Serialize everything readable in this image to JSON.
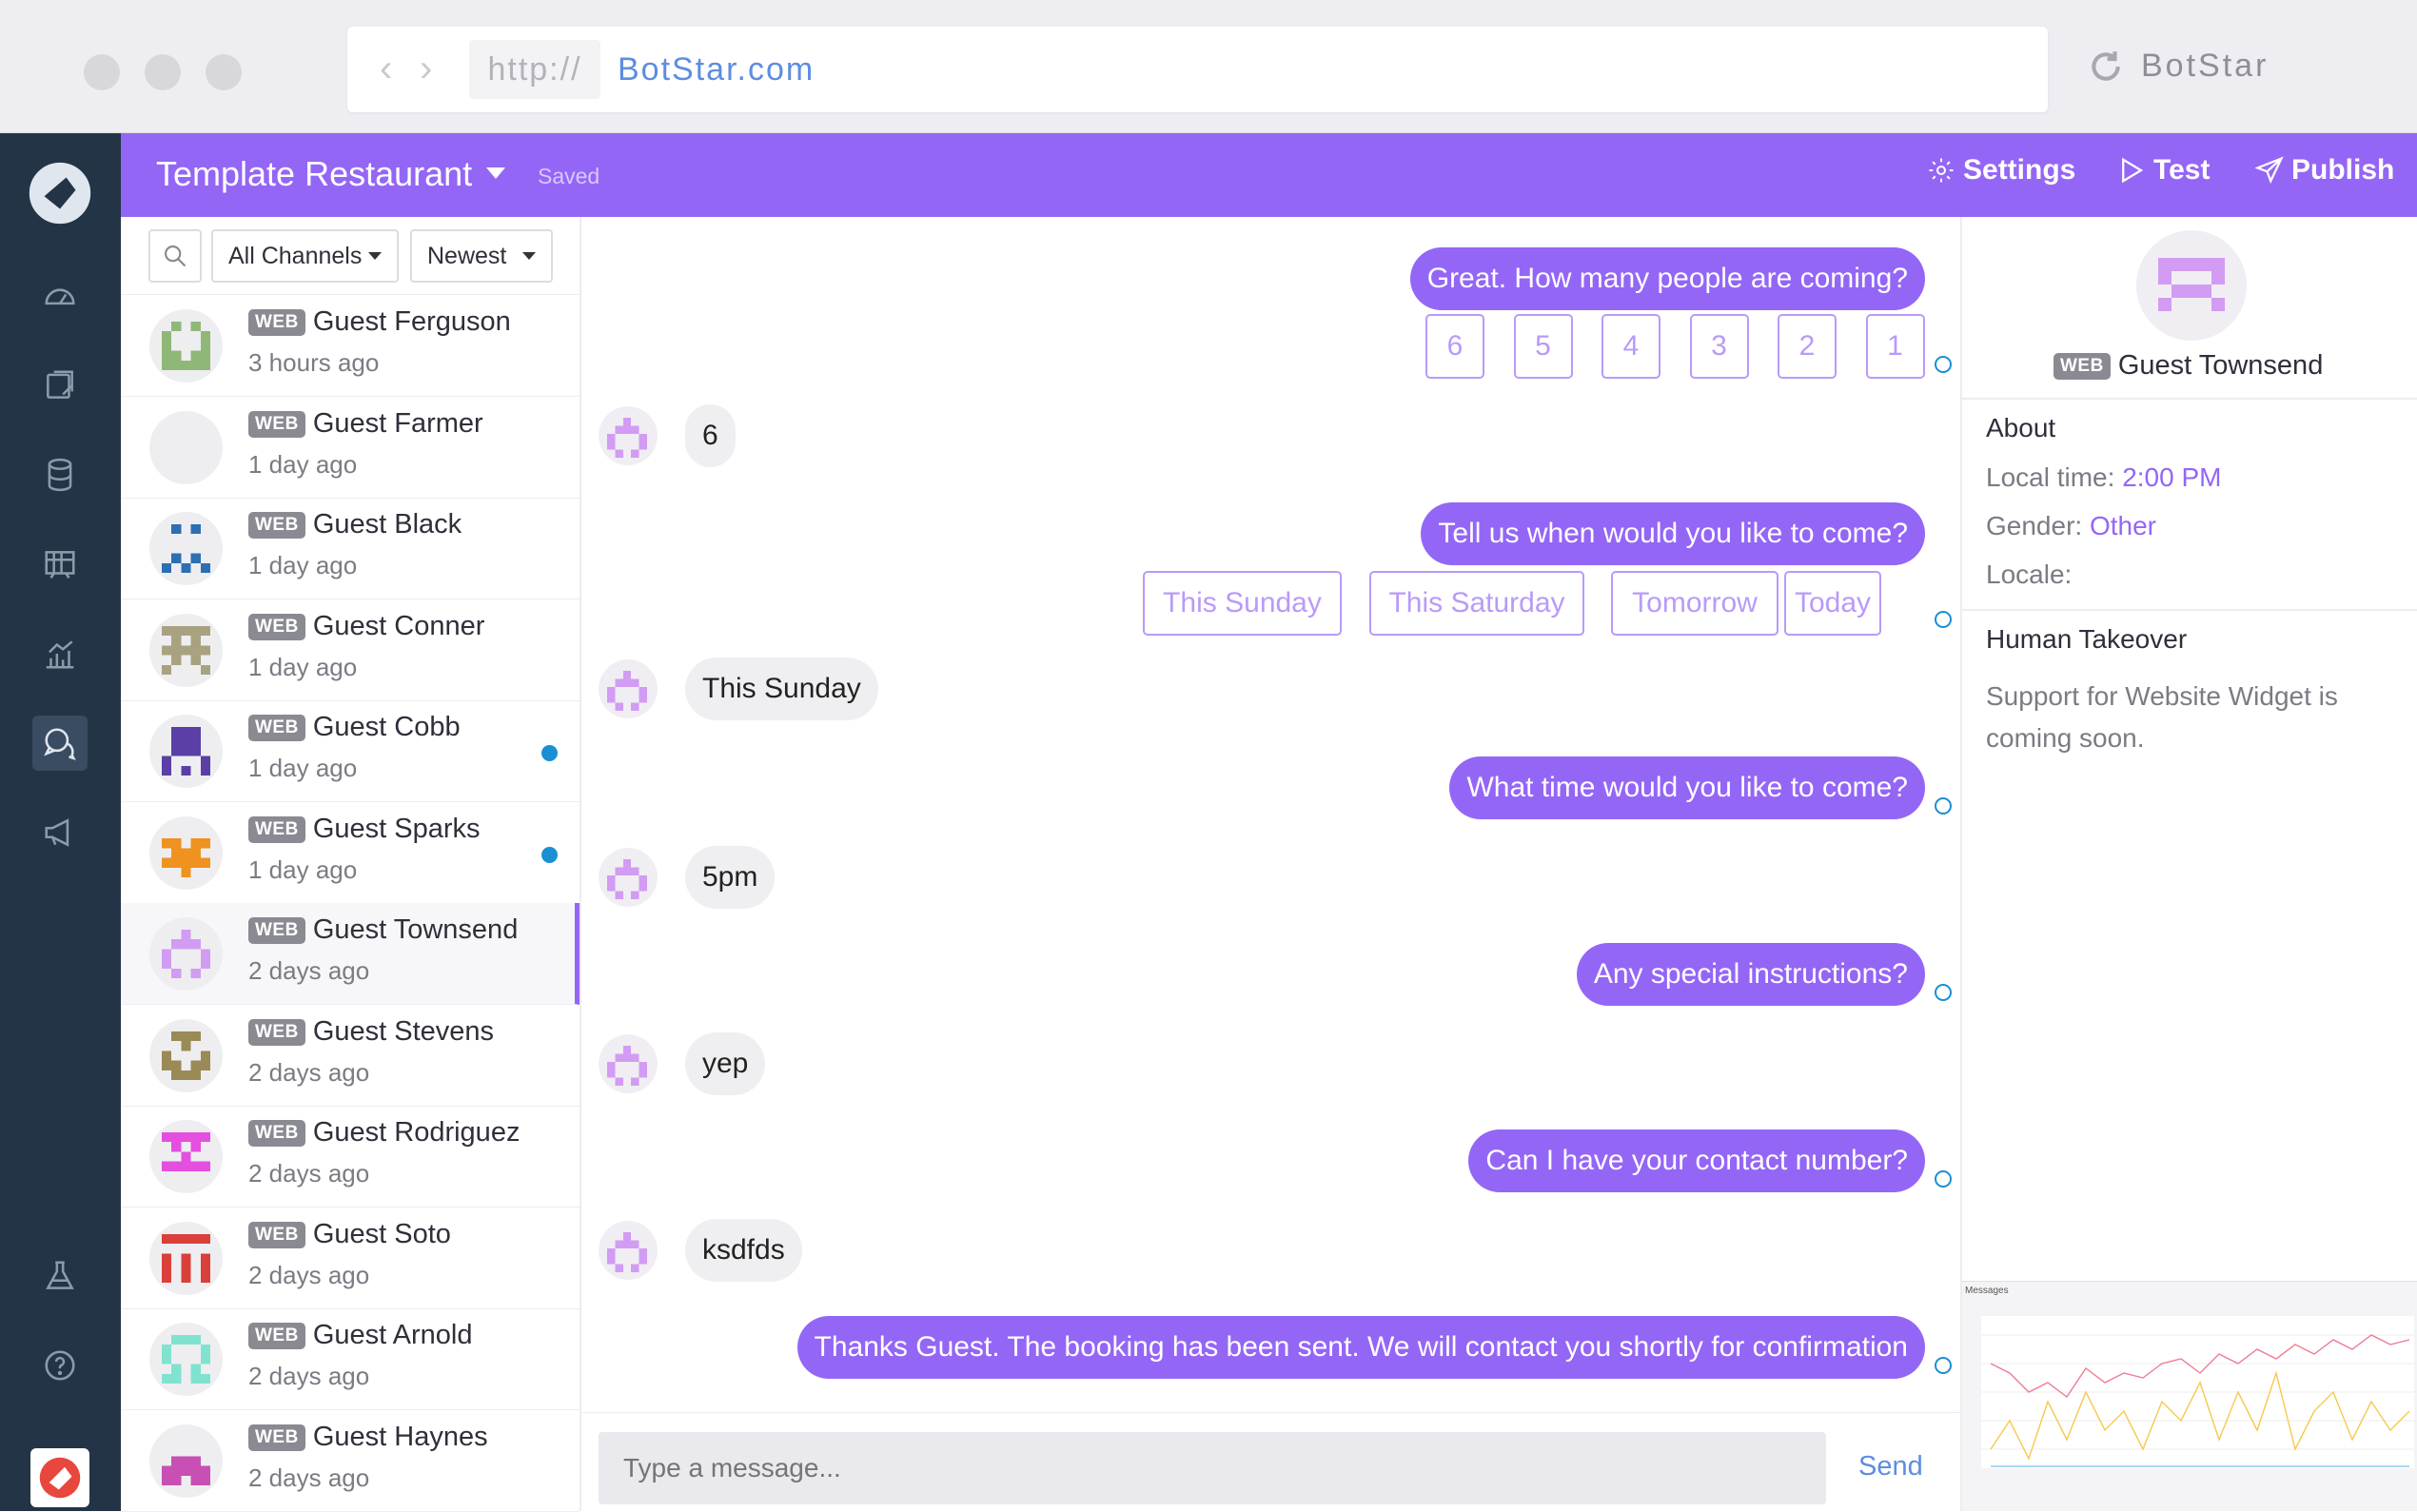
{
  "browser": {
    "url_protocol": "http://",
    "url_domain": "BotStar.com",
    "brand": "BotStar"
  },
  "topbar": {
    "title": "Template Restaurant",
    "status": "Saved",
    "settings_label": "Settings",
    "test_label": "Test",
    "publish_label": "Publish"
  },
  "filters": {
    "channel": "All Channels",
    "sort": "Newest"
  },
  "conversations": [
    {
      "channel": "WEB",
      "name": "Guest Ferguson",
      "time": "3 hours ago",
      "color": "#8fb878",
      "unread": false
    },
    {
      "channel": "WEB",
      "name": "Guest Farmer",
      "time": "1 day ago",
      "color": "#e6d00a",
      "unread": false
    },
    {
      "channel": "WEB",
      "name": "Guest Black",
      "time": "1 day ago",
      "color": "#2c6fb2",
      "unread": false
    },
    {
      "channel": "WEB",
      "name": "Guest Conner",
      "time": "1 day ago",
      "color": "#a9a280",
      "unread": false
    },
    {
      "channel": "WEB",
      "name": "Guest Cobb",
      "time": "1 day ago",
      "color": "#5a3fa6",
      "unread": true
    },
    {
      "channel": "WEB",
      "name": "Guest Sparks",
      "time": "1 day ago",
      "color": "#ef9220",
      "unread": true
    },
    {
      "channel": "WEB",
      "name": "Guest Townsend",
      "time": "2 days ago",
      "color": "#d29cf3",
      "unread": false
    },
    {
      "channel": "WEB",
      "name": "Guest Stevens",
      "time": "2 days ago",
      "color": "#9a8a56",
      "unread": false
    },
    {
      "channel": "WEB",
      "name": "Guest Rodriguez",
      "time": "2 days ago",
      "color": "#e44fe0",
      "unread": false
    },
    {
      "channel": "WEB",
      "name": "Guest Soto",
      "time": "2 days ago",
      "color": "#d9403a",
      "unread": false
    },
    {
      "channel": "WEB",
      "name": "Guest Arnold",
      "time": "2 days ago",
      "color": "#7fe3cf",
      "unread": false
    },
    {
      "channel": "WEB",
      "name": "Guest Haynes",
      "time": "2 days ago",
      "color": "#c84fb4",
      "unread": false
    }
  ],
  "chat": {
    "messages": [
      {
        "from": "bot",
        "text": "Great. How many people are coming?",
        "quick_replies": [
          "6",
          "5",
          "4",
          "3",
          "2",
          "1"
        ]
      },
      {
        "from": "user",
        "text": "6"
      },
      {
        "from": "bot",
        "text": "Tell us when would you like to come?",
        "quick_replies": [
          "This Sunday",
          "This Saturday",
          "Tomorrow",
          "Today"
        ]
      },
      {
        "from": "user",
        "text": "This Sunday"
      },
      {
        "from": "bot",
        "text": "What time would you like to come?"
      },
      {
        "from": "user",
        "text": "5pm"
      },
      {
        "from": "bot",
        "text": "Any special instructions?"
      },
      {
        "from": "user",
        "text": "yep"
      },
      {
        "from": "bot",
        "text": "Can I have your contact number?"
      },
      {
        "from": "user",
        "text": "ksdfds"
      },
      {
        "from": "bot",
        "text": "Thanks Guest. The booking has been sent. We will contact you shortly for confirmation"
      }
    ],
    "composer_placeholder": "Type a message...",
    "send_label": "Send"
  },
  "profile": {
    "channel": "WEB",
    "name": "Guest Townsend",
    "about_label": "About",
    "local_time_label": "Local time:",
    "local_time": "2:00 PM",
    "gender_label": "Gender:",
    "gender": "Other",
    "locale_label": "Locale:",
    "takeover_label": "Human Takeover",
    "takeover_note": "Support for Website Widget is coming soon.",
    "mini_chart_title": "Messages"
  },
  "colors": {
    "accent": "#9466f6",
    "sidebar": "#233447",
    "link": "#5d8de0",
    "unread": "#1a8fd3"
  }
}
